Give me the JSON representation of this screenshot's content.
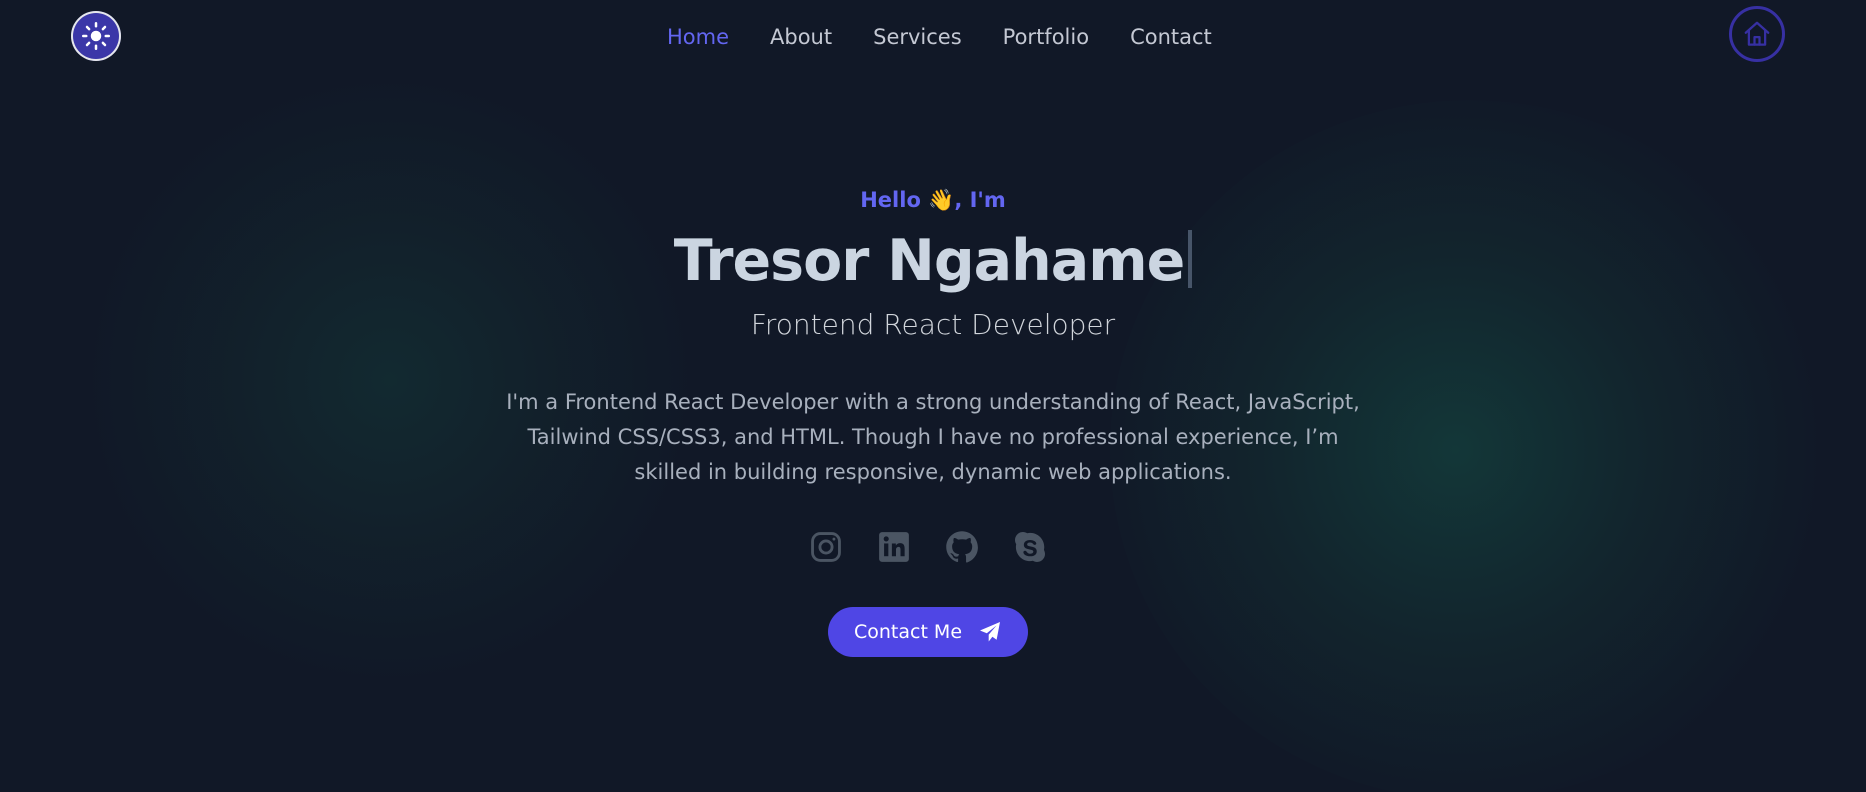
{
  "header": {
    "theme_toggle_icon": "sun-icon",
    "nav": [
      {
        "label": "Home",
        "active": true
      },
      {
        "label": "About",
        "active": false
      },
      {
        "label": "Services",
        "active": false
      },
      {
        "label": "Portfolio",
        "active": false
      },
      {
        "label": "Contact",
        "active": false
      }
    ],
    "home_icon": "home-icon"
  },
  "hero": {
    "greeting": "Hello 👋, I'm",
    "name": "Tresor Ngahame",
    "role": "Frontend React Developer",
    "bio": "I'm a Frontend React Developer with a strong understanding of React, JavaScript, Tailwind CSS/CSS3, and HTML. Though I have no professional experience, I’m skilled in building responsive, dynamic web applications.",
    "socials": [
      "instagram-icon",
      "linkedin-icon",
      "github-icon",
      "skype-icon"
    ],
    "contact_button": "Contact Me",
    "contact_icon": "paper-plane-icon"
  },
  "colors": {
    "background": "#111827",
    "accent": "#6366f1",
    "button": "#4f46e5",
    "text": "#cbd5e1",
    "muted": "#a8b0bd",
    "icon": "#4b5563"
  }
}
